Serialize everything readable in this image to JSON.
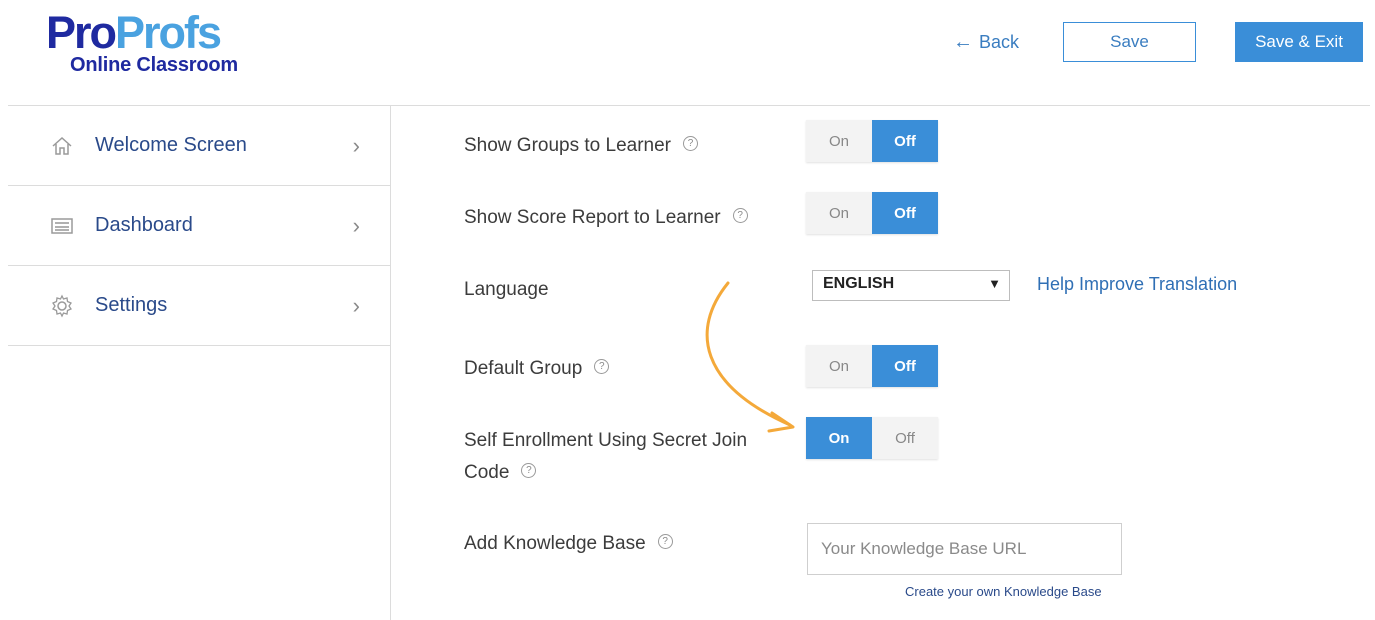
{
  "logo": {
    "part1": "Pro",
    "part2": "Profs",
    "subtitle": "Online Classroom"
  },
  "header": {
    "back_label": "Back",
    "save_label": "Save",
    "save_exit_label": "Save & Exit"
  },
  "sidebar": {
    "items": [
      {
        "label": "Welcome Screen",
        "icon": "home-icon"
      },
      {
        "label": "Dashboard",
        "icon": "dashboard-icon"
      },
      {
        "label": "Settings",
        "icon": "gear-icon"
      }
    ]
  },
  "settings": {
    "show_groups": {
      "label": "Show Groups to Learner",
      "on": "On",
      "off": "Off",
      "value": "Off"
    },
    "show_score": {
      "label": "Show Score Report to Learner",
      "on": "On",
      "off": "Off",
      "value": "Off"
    },
    "language": {
      "label": "Language",
      "selected": "ENGLISH",
      "help_link": "Help Improve Translation"
    },
    "default_group": {
      "label": "Default Group",
      "on": "On",
      "off": "Off",
      "value": "Off"
    },
    "self_enrollment": {
      "label_line1": "Self Enrollment Using Secret Join",
      "label_line2": "Code",
      "on": "On",
      "off": "Off",
      "value": "On"
    },
    "knowledge_base": {
      "label": "Add Knowledge Base",
      "placeholder": "Your Knowledge Base URL",
      "create_link": "Create your own Knowledge Base"
    }
  },
  "help_glyph": "?",
  "colors": {
    "accent": "#3a8ed8",
    "brand_dark": "#1f2aa0",
    "brand_light": "#4aa2e0",
    "annotation": "#f4a93a"
  }
}
